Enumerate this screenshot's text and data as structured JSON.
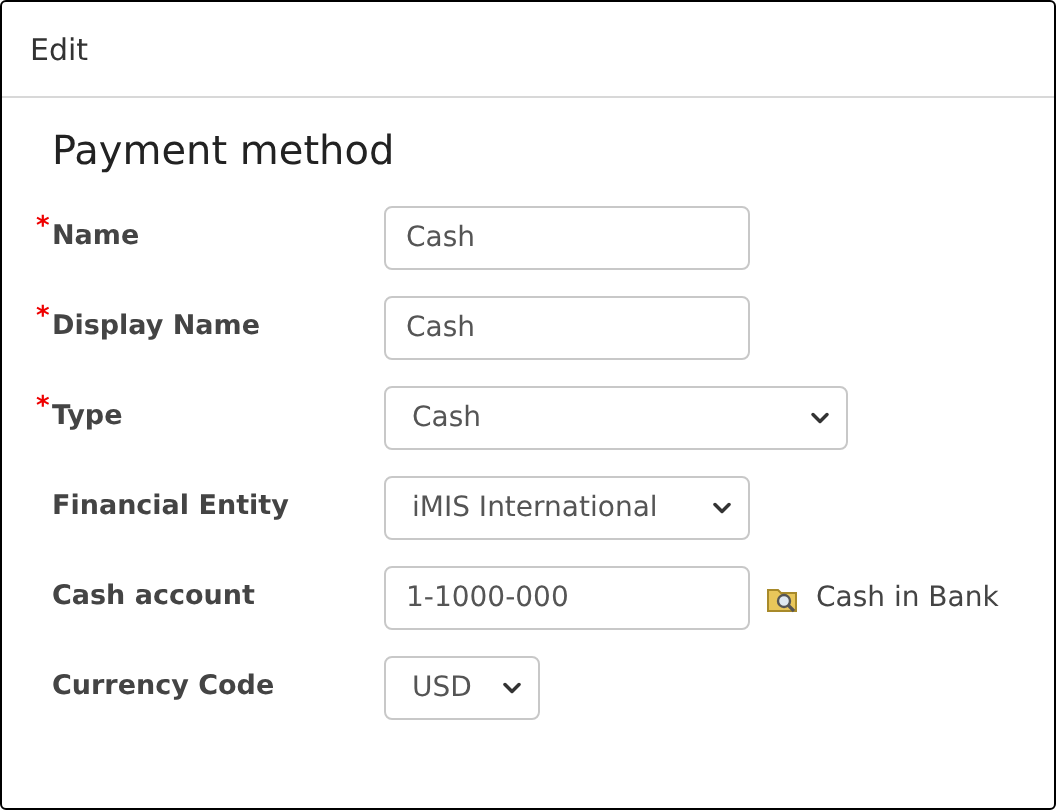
{
  "window": {
    "title": "Edit"
  },
  "section": {
    "title": "Payment method"
  },
  "fields": [
    {
      "label": "Name",
      "required_mark": "*",
      "kind": "text",
      "value": "Cash"
    },
    {
      "label": "Display Name",
      "required_mark": "*",
      "kind": "text",
      "value": "Cash"
    },
    {
      "label": "Type",
      "required_mark": "*",
      "kind": "select",
      "value": "Cash"
    },
    {
      "label": "Financial Entity",
      "kind": "select",
      "value": "iMIS International"
    },
    {
      "label": "Cash account",
      "kind": "lookup",
      "value": "1-1000-000",
      "description": "Cash in Bank"
    },
    {
      "label": "Currency Code",
      "kind": "select",
      "value": "USD"
    }
  ]
}
